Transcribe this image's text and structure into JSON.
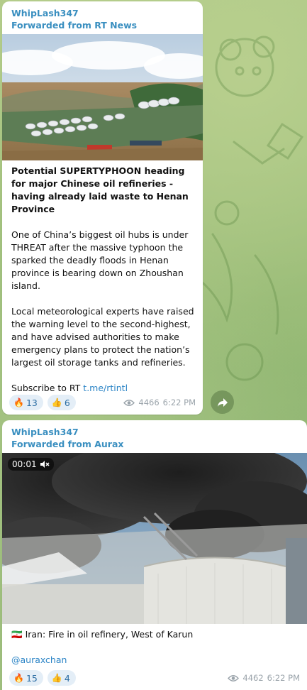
{
  "messages": [
    {
      "sender": "WhipLash347",
      "forwarded": "Forwarded from RT News",
      "headline": "Potential SUPERTYPHOON heading for major Chinese oil refineries - having already laid waste to Henan Province",
      "para1": "One of China’s biggest oil hubs is under THREAT after the massive typhoon the sparked the deadly floods in Henan province is bearing down on Zhoushan island.",
      "para2": "Local meteorological experts have raised the warning level to the second-highest, and have advised authorities to make emergency plans to protect the nation’s largest oil storage tanks and refineries.",
      "subscribe_text": "Subscribe to RT ",
      "subscribe_link": "t.me/rtintl",
      "reactions": [
        {
          "emoji": "🔥",
          "count": "13"
        },
        {
          "emoji": "👍",
          "count": "6"
        }
      ],
      "views": "4466",
      "time": "6:22 PM"
    },
    {
      "sender": "WhipLash347",
      "forwarded": "Forwarded from Aurax",
      "video_time": "00:01",
      "caption_flag": "🇮🇷",
      "caption": "Iran: Fire in oil refinery, West of Karun",
      "handle": "@auraxchan",
      "reactions": [
        {
          "emoji": "🔥",
          "count": "15"
        },
        {
          "emoji": "👍",
          "count": "4"
        }
      ],
      "views": "4462",
      "time": "6:22 PM"
    }
  ],
  "icons": {
    "views": "eye-icon",
    "share": "share-arrow-icon",
    "mute": "mute-icon"
  },
  "colors": {
    "accent": "#3a8fc0",
    "link": "#2b84c6",
    "chat_background": "#9fbf7f"
  }
}
